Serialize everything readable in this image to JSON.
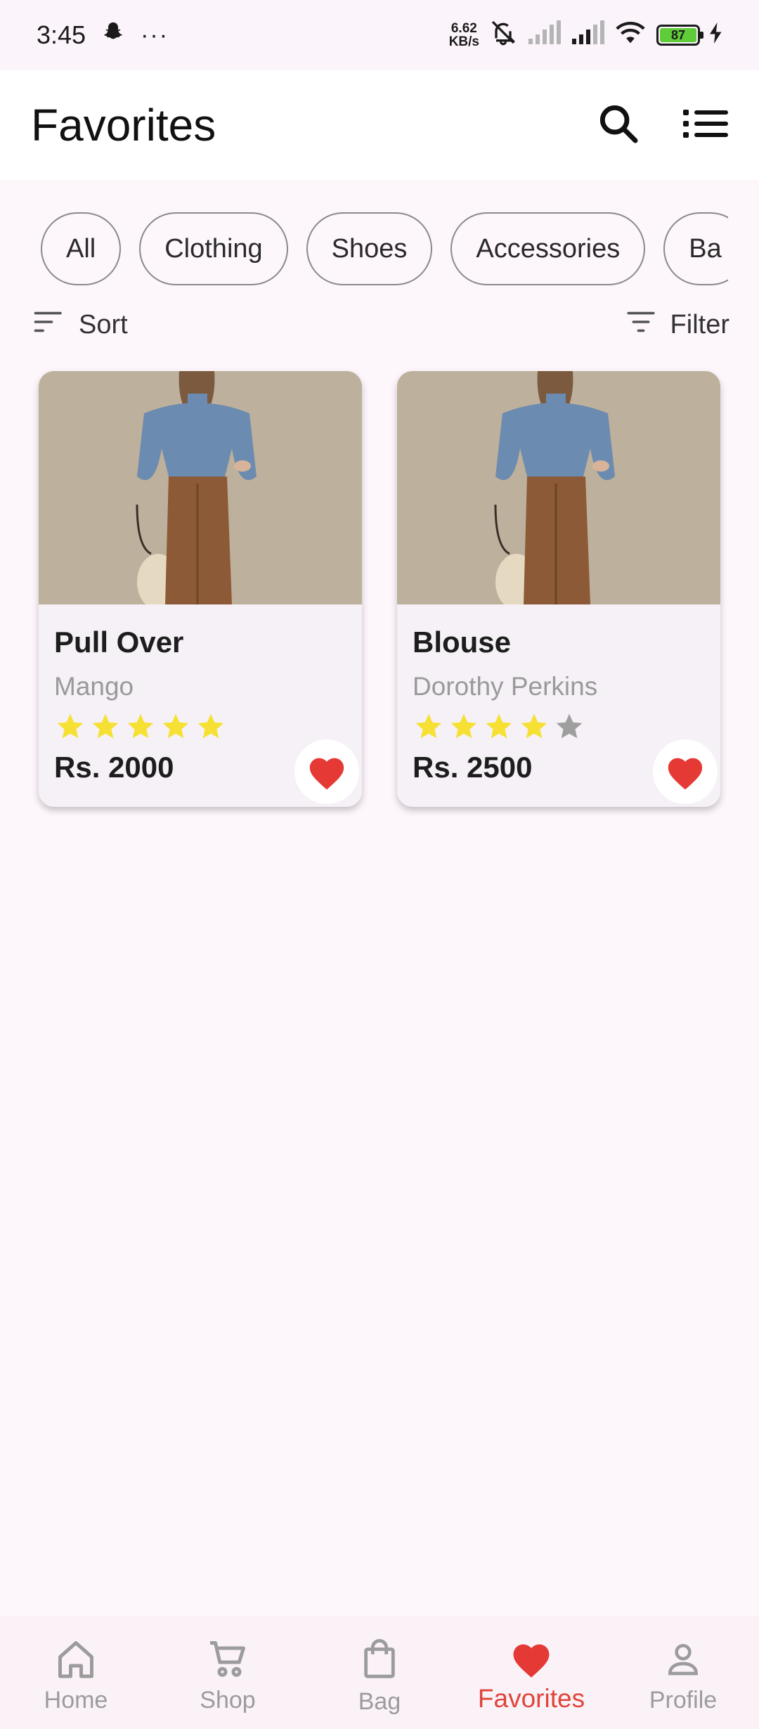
{
  "status_bar": {
    "time": "3:45",
    "more": "···",
    "net_speed_value": "6.62",
    "net_speed_unit": "KB/s",
    "battery": "87"
  },
  "header": {
    "title": "Favorites",
    "icons": [
      "search-icon",
      "list-view-icon"
    ]
  },
  "chips": [
    "All",
    "Clothing",
    "Shoes",
    "Accessories",
    "Ba"
  ],
  "toolbar": {
    "sort_label": "Sort",
    "filter_label": "Filter"
  },
  "products": [
    {
      "name": "Pull Over",
      "brand": "Mango",
      "rating": 5,
      "price": "Rs. 2000",
      "favorite": true
    },
    {
      "name": "Blouse",
      "brand": "Dorothy Perkins",
      "rating": 4,
      "price": "Rs. 2500",
      "favorite": true
    }
  ],
  "nav": [
    {
      "label": "Home",
      "icon": "home-icon",
      "active": false
    },
    {
      "label": "Shop",
      "icon": "cart-icon",
      "active": false
    },
    {
      "label": "Bag",
      "icon": "bag-icon",
      "active": false
    },
    {
      "label": "Favorites",
      "icon": "heart-icon",
      "active": true
    },
    {
      "label": "Profile",
      "icon": "profile-icon",
      "active": false
    }
  ],
  "colors": {
    "accent": "#e0453a",
    "star_filled": "#f7e034",
    "star_empty": "#9e9e9e",
    "background": "#fdf6fb"
  }
}
